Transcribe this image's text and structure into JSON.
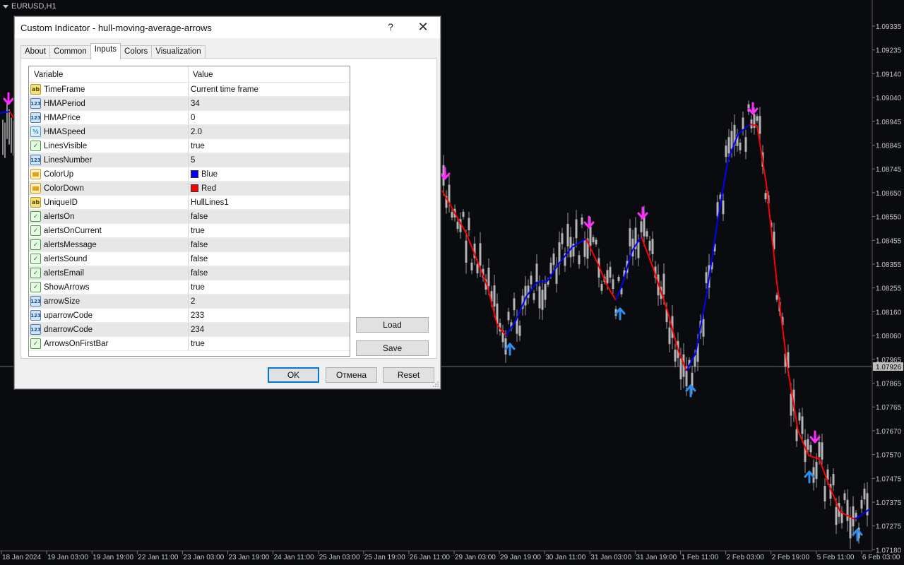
{
  "chart": {
    "symbol": "EURUSD,H1",
    "price_labels": [
      "1.09335",
      "1.09235",
      "1.09140",
      "1.09040",
      "1.08945",
      "1.08845",
      "1.08745",
      "1.08650",
      "1.08550",
      "1.08455",
      "1.08355",
      "1.08255",
      "1.08160",
      "1.08060",
      "1.07965",
      "1.07865",
      "1.07765",
      "1.07670",
      "1.07570",
      "1.07475",
      "1.07375",
      "1.07275",
      "1.07180"
    ],
    "current_price": "1.07926",
    "time_labels": [
      "18 Jan 2024",
      "19 Jan 03:00",
      "19 Jan 19:00",
      "22 Jan 11:00",
      "23 Jan 03:00",
      "23 Jan 19:00",
      "24 Jan 11:00",
      "25 Jan 03:00",
      "25 Jan 19:00",
      "26 Jan 11:00",
      "29 Jan 03:00",
      "29 Jan 19:00",
      "30 Jan 11:00",
      "31 Jan 03:00",
      "31 Jan 19:00",
      "1 Feb 11:00",
      "2 Feb 03:00",
      "2 Feb 19:00",
      "5 Feb 11:00",
      "6 Feb 03:00"
    ],
    "colors": {
      "background": "#0a0b0f",
      "up_line": "#0000ff",
      "down_line": "#ff0000",
      "up_arrow": "#2f8ff0",
      "down_arrow": "#ff2bff",
      "candles": "#b4b4b4"
    }
  },
  "dialog": {
    "title": "Custom Indicator - hull-moving-average-arrows",
    "help_label": "?",
    "close_label": "✕",
    "tabs": [
      {
        "label": "About"
      },
      {
        "label": "Common"
      },
      {
        "label": "Inputs"
      },
      {
        "label": "Colors"
      },
      {
        "label": "Visualization"
      }
    ],
    "active_tab": "Inputs",
    "table": {
      "header_variable": "Variable",
      "header_value": "Value",
      "rows": [
        {
          "icon": "ab",
          "variable": "TimeFrame",
          "value": "Current time frame"
        },
        {
          "icon": "123",
          "variable": "HMAPeriod",
          "value": "34"
        },
        {
          "icon": "123",
          "variable": "HMAPrice",
          "value": "0"
        },
        {
          "icon": "half",
          "variable": "HMASpeed",
          "value": "2.0"
        },
        {
          "icon": "bool",
          "variable": "LinesVisible",
          "value": "true"
        },
        {
          "icon": "123",
          "variable": "LinesNumber",
          "value": "5"
        },
        {
          "icon": "color",
          "variable": "ColorUp",
          "value": "Blue",
          "swatch": "#0000ff"
        },
        {
          "icon": "color",
          "variable": "ColorDown",
          "value": "Red",
          "swatch": "#ff0000"
        },
        {
          "icon": "ab",
          "variable": "UniqueID",
          "value": "HullLines1"
        },
        {
          "icon": "bool",
          "variable": "alertsOn",
          "value": "false"
        },
        {
          "icon": "bool",
          "variable": "alertsOnCurrent",
          "value": "true"
        },
        {
          "icon": "bool",
          "variable": "alertsMessage",
          "value": "false"
        },
        {
          "icon": "bool",
          "variable": "alertsSound",
          "value": "false"
        },
        {
          "icon": "bool",
          "variable": "alertsEmail",
          "value": "false"
        },
        {
          "icon": "bool",
          "variable": "ShowArrows",
          "value": "true"
        },
        {
          "icon": "123",
          "variable": "arrowSize",
          "value": "2"
        },
        {
          "icon": "123",
          "variable": "uparrowCode",
          "value": "233"
        },
        {
          "icon": "123",
          "variable": "dnarrowCode",
          "value": "234"
        },
        {
          "icon": "bool",
          "variable": "ArrowsOnFirstBar",
          "value": "true"
        }
      ]
    },
    "load_label": "Load",
    "save_label": "Save",
    "ok_label": "OK",
    "cancel_label": "Отмена",
    "reset_label": "Reset"
  }
}
